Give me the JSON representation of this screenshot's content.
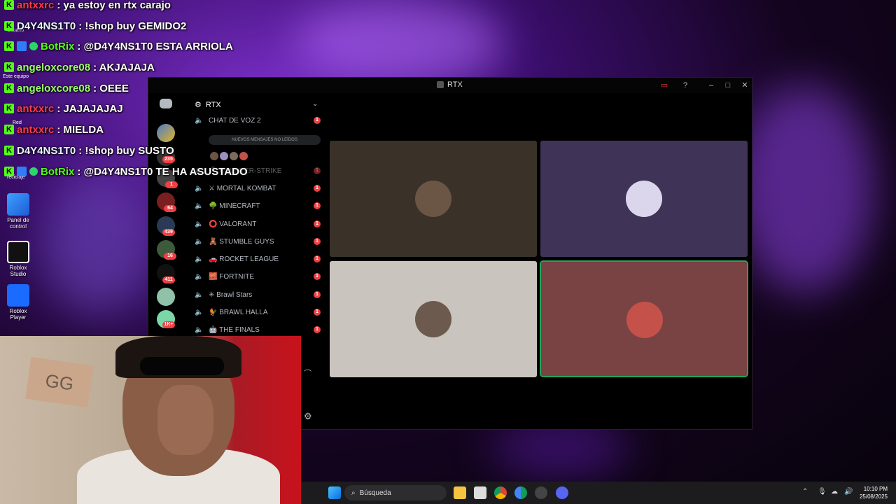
{
  "chat": [
    {
      "user": "antxxrc",
      "message": ": ya estoy en rtx carajo",
      "user_color": "red"
    },
    {
      "user": "D4Y4NS1T0",
      "message": ": !shop buy GEMIDO2",
      "user_color": "white"
    },
    {
      "user": "BotRix",
      "message": ": @D4Y4NS1T0 ESTA ARRIOLA",
      "user_color": "bot"
    },
    {
      "user": "angeloxcore08",
      "message": ": AKJAJAJA",
      "user_color": "green"
    },
    {
      "user": "angeloxcore08",
      "message": ": OEEE",
      "user_color": "green"
    },
    {
      "user": "antxxrc",
      "message": ": JAJAJAJAJ",
      "user_color": "red"
    },
    {
      "user": "antxxrc",
      "message": ": MIELDA",
      "user_color": "red"
    },
    {
      "user": "D4Y4NS1T0",
      "message": ": !shop buy SUSTO",
      "user_color": "white"
    },
    {
      "user": "BotRix",
      "message": ": @D4Y4NS1T0 TE HA ASUSTADO",
      "user_color": "bot"
    }
  ],
  "desktop_icons": [
    {
      "label": "Panel de control",
      "icon": "control-panel-icon"
    },
    {
      "label": "Roblox Studio",
      "icon": "roblox-studio-icon"
    },
    {
      "label": "Roblox Player",
      "icon": "roblox-player-icon"
    }
  ],
  "desktop_partial_labels": [
    "Usuario",
    "Este equipo",
    "Red",
    "reciclaje"
  ],
  "window": {
    "title": "RTX",
    "server_name": "RTX",
    "new_messages_banner": "NUEVOS MENSAJES NO LEÍDOS",
    "partial_channel_top": "CHAT DE VOZ 2",
    "channels": [
      {
        "label": "COUNTER-STRIKE",
        "emoji": "🎖",
        "unread": "1"
      },
      {
        "label": "MORTAL KOMBAT",
        "emoji": "⚔",
        "unread": "1"
      },
      {
        "label": "MINECRAFT",
        "emoji": "🌳",
        "unread": "1"
      },
      {
        "label": "VALORANT",
        "emoji": "⭕",
        "unread": "1"
      },
      {
        "label": "STUMBLE GUYS",
        "emoji": "🧸",
        "unread": "1"
      },
      {
        "label": "ROCKET LEAGUE",
        "emoji": "🚗",
        "unread": "1"
      },
      {
        "label": "FORTNITE",
        "emoji": "🧱",
        "unread": "1"
      },
      {
        "label": "Brawl Stars",
        "emoji": "✳",
        "unread": "1"
      },
      {
        "label": "BRAWL HALLA",
        "emoji": "🐓",
        "unread": "1"
      },
      {
        "label": "THE FINALS",
        "emoji": "🤖",
        "unread": "1"
      }
    ],
    "guild_badges": [
      "235",
      "1",
      "64",
      "439",
      "16",
      "411",
      "1K+"
    ],
    "tiles": [
      {
        "bg": "#3a3128",
        "avatar": "#6b5646",
        "speaking": false
      },
      {
        "bg": "#3f3458",
        "avatar": "#dcd6ec",
        "speaking": false
      },
      {
        "bg": "#c9c4bd",
        "avatar": "#6c5a4e",
        "speaking": false
      },
      {
        "bg": "#7a4343",
        "avatar": "#c4524a",
        "speaking": true
      }
    ]
  },
  "taskbar": {
    "search_placeholder": "Búsqueda",
    "time": "10:10 PM",
    "date": "25/08/2025"
  }
}
